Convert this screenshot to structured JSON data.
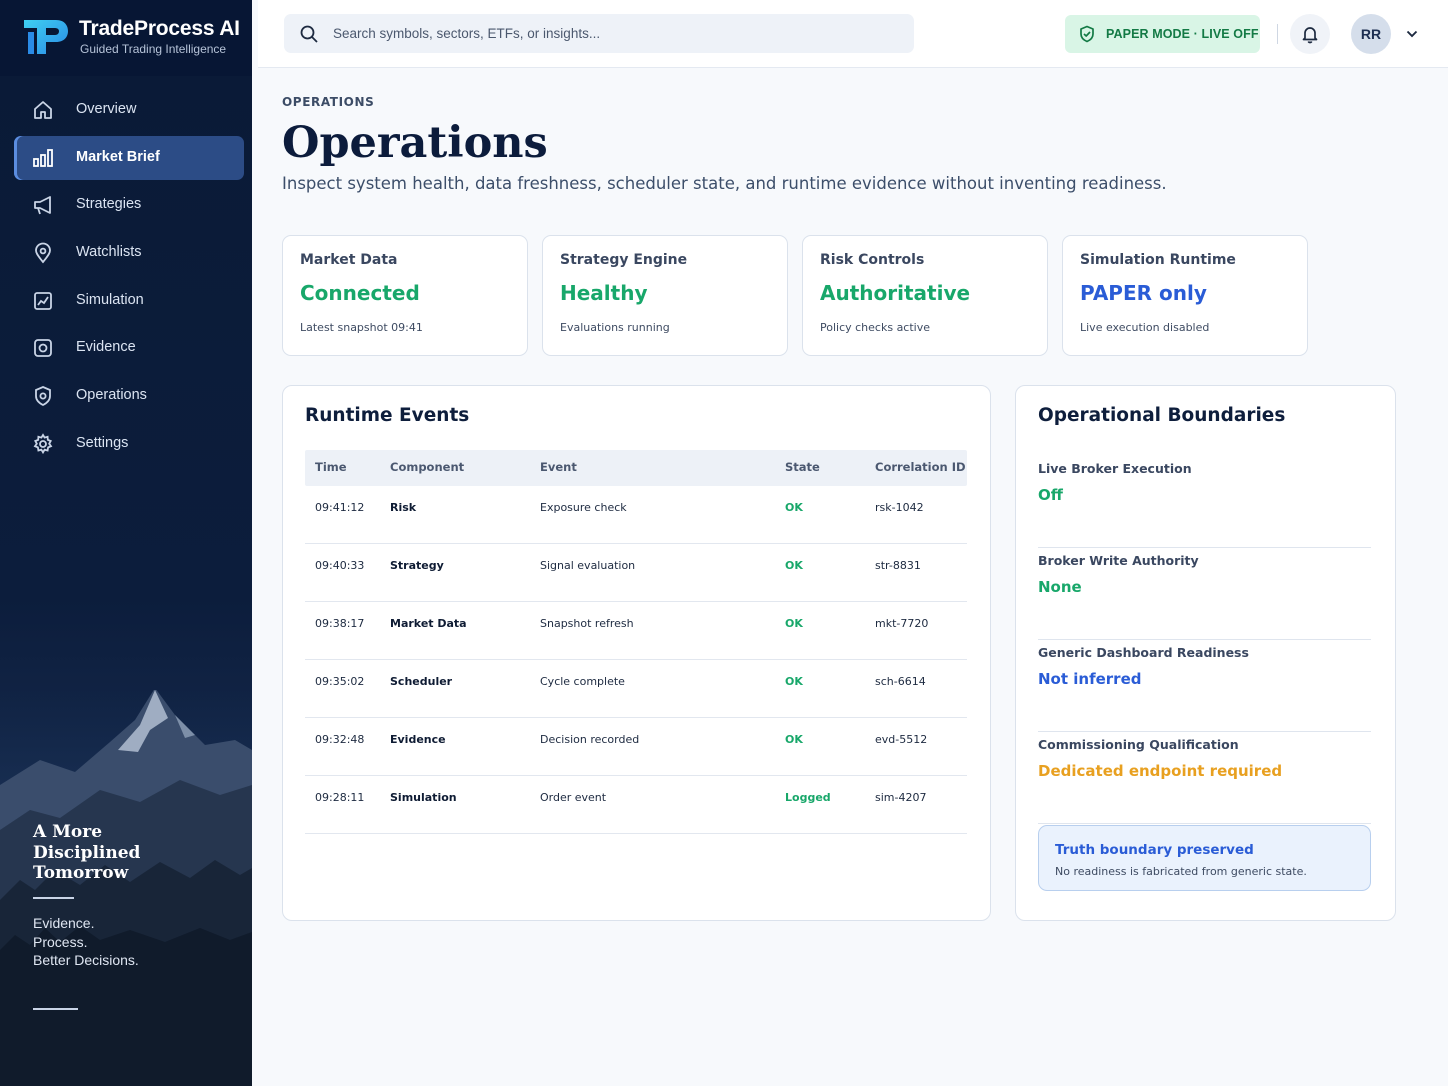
{
  "brand": {
    "title": "TradeProcess AI",
    "subtitle": "Guided Trading Intelligence"
  },
  "nav": {
    "items": [
      {
        "label": "Overview",
        "icon": "home-icon",
        "active": false
      },
      {
        "label": "Market Brief",
        "icon": "bar-chart-icon",
        "active": true
      },
      {
        "label": "Strategies",
        "icon": "megaphone-icon",
        "active": false
      },
      {
        "label": "Watchlists",
        "icon": "location-pin-icon",
        "active": false
      },
      {
        "label": "Simulation",
        "icon": "simulation-icon",
        "active": false
      },
      {
        "label": "Evidence",
        "icon": "camera-icon",
        "active": false
      },
      {
        "label": "Operations",
        "icon": "shield-gear-icon",
        "active": false
      },
      {
        "label": "Settings",
        "icon": "gear-icon",
        "active": false
      }
    ]
  },
  "promo": {
    "tagline_1": "A More",
    "tagline_2": "Disciplined",
    "tagline_3": "Tomorrow",
    "point_1": "Evidence.",
    "point_2": "Process.",
    "point_3": "Better Decisions."
  },
  "topbar": {
    "search_placeholder": "Search symbols, sectors, ETFs, or insights...",
    "mode_badge": "PAPER MODE · LIVE OFF",
    "avatar_initials": "RR"
  },
  "page": {
    "eyebrow": "OPERATIONS",
    "title": "Operations",
    "subtitle": "Inspect system health, data freshness, scheduler state, and runtime evidence without inventing readiness."
  },
  "status_cards": [
    {
      "label": "Market Data",
      "value": "Connected",
      "note": "Latest snapshot 09:41",
      "color": "#18a76a"
    },
    {
      "label": "Strategy Engine",
      "value": "Healthy",
      "note": "Evaluations running",
      "color": "#18a76a"
    },
    {
      "label": "Risk Controls",
      "value": "Authoritative",
      "note": "Policy checks active",
      "color": "#18a76a"
    },
    {
      "label": "Simulation Runtime",
      "value": "PAPER only",
      "note": "Live execution disabled",
      "color": "#2a5cd6"
    }
  ],
  "events": {
    "title": "Runtime Events",
    "columns": [
      "Time",
      "Component",
      "Event",
      "State",
      "Correlation ID"
    ],
    "rows": [
      [
        "09:41:12",
        "Risk",
        "Exposure check",
        "OK",
        "rsk-1042"
      ],
      [
        "09:40:33",
        "Strategy",
        "Signal evaluation",
        "OK",
        "str-8831"
      ],
      [
        "09:38:17",
        "Market Data",
        "Snapshot refresh",
        "OK",
        "mkt-7720"
      ],
      [
        "09:35:02",
        "Scheduler",
        "Cycle complete",
        "OK",
        "sch-6614"
      ],
      [
        "09:32:48",
        "Evidence",
        "Decision recorded",
        "OK",
        "evd-5512"
      ],
      [
        "09:28:11",
        "Simulation",
        "Order event",
        "Logged",
        "sim-4207"
      ]
    ]
  },
  "boundaries": {
    "title": "Operational Boundaries",
    "items": [
      {
        "label": "Live Broker Execution",
        "value": "Off",
        "color": "#18a76a"
      },
      {
        "label": "Broker Write Authority",
        "value": "None",
        "color": "#18a76a"
      },
      {
        "label": "Generic Dashboard Readiness",
        "value": "Not inferred",
        "color": "#2a5cd6"
      },
      {
        "label": "Commissioning Qualification",
        "value": "Dedicated endpoint required",
        "color": "#e8a020"
      }
    ],
    "note_title": "Truth boundary preserved",
    "note_text": "No readiness is fabricated from generic state."
  }
}
